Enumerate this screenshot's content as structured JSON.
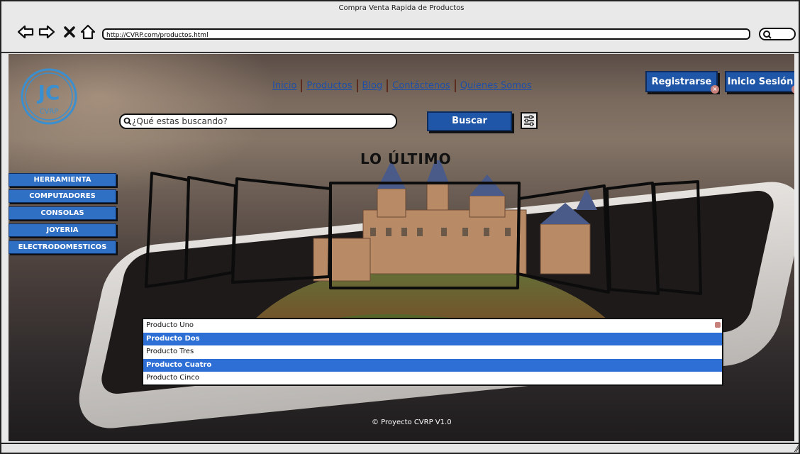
{
  "window": {
    "title": "Compra Venta Rapida de Productos",
    "url": "http://CVRP.com/productos.html"
  },
  "logo": {
    "monogram": "JC",
    "text": "CVRP"
  },
  "nav": {
    "links": [
      "Inicio",
      "Productos",
      "Blog",
      "Contáctenos",
      "Quienes Somos"
    ]
  },
  "header_buttons": {
    "register": "Registrarse",
    "login": "Inicio Sesión"
  },
  "search": {
    "placeholder": "¿Qué estas buscando?",
    "button": "Buscar"
  },
  "section_heading": "LO ÚLTIMO",
  "categories": [
    "HERRAMIENTA",
    "COMPUTADORES",
    "CONSOLAS",
    "JOYERIA",
    "ELECTRODOMESTICOS"
  ],
  "products": [
    {
      "name": "Producto Uno",
      "selected": false
    },
    {
      "name": "Producto Dos",
      "selected": true
    },
    {
      "name": "Producto Tres",
      "selected": false
    },
    {
      "name": "Producto Cuatro",
      "selected": true
    },
    {
      "name": "Producto Cinco",
      "selected": false
    }
  ],
  "footer": "© Proyecto CVRP V1.0",
  "colors": {
    "accent": "#1f56a8",
    "selection": "#2e6fd6",
    "link": "#1e4fa8"
  },
  "icons": [
    "back-arrow-icon",
    "forward-arrow-icon",
    "close-icon",
    "home-icon",
    "search-icon",
    "filter-icon",
    "resize-grip-icon"
  ]
}
